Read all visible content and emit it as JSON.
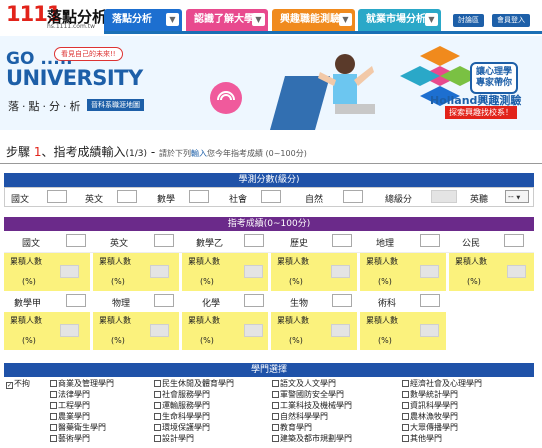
{
  "header": {
    "logo_num": "1111",
    "logo_text": "落點分析",
    "logo_url": "hs.1111.com.tw",
    "tabs": [
      {
        "label": "落點分析",
        "color": "#1d6fd0"
      },
      {
        "label": "認識了解大學",
        "color": "#e84a8e"
      },
      {
        "label": "興趣職能測驗",
        "color": "#f08a1d"
      },
      {
        "label": "就業市場分析",
        "color": "#2aa8c8"
      }
    ],
    "login": "討論區",
    "member": "會員登入"
  },
  "banner": {
    "bubble": "看見自己的未來!!",
    "go": "GO .....",
    "university": "UNIVERSITY",
    "zh": "落‧點‧分‧析",
    "map": "晉科系職涯地圖",
    "right_title": "讓心理學\n專家帶你",
    "holland": "Holland興趣測驗",
    "holland_sub": "探索興趣找校系！"
  },
  "step": {
    "prefix": "步驟 ",
    "num": "1",
    "title": "、指考成績輸入",
    "pages": "(1/3)",
    "dash": " - ",
    "hint_a": "請於下列",
    "hint_b": "輸入",
    "hint_c": "您今年指考成績 (0~100分)"
  },
  "gsat": {
    "header": "學測分數(級分)",
    "fields": [
      "國文",
      "英文",
      "數學",
      "社會",
      "自然",
      "總級分",
      "英聽"
    ],
    "select_value": "--"
  },
  "ast": {
    "header": "指考成績(0~100分)",
    "row1": [
      "國文",
      "英文",
      "數學乙",
      "歷史",
      "地理",
      "公民"
    ],
    "row2": [
      "數學甲",
      "物理",
      "化學",
      "生物",
      "術科"
    ],
    "cum_label": "累積人數",
    "pct_label": "(%)"
  },
  "majors": {
    "header": "學門選擇",
    "col1": [
      "不拘",
      "",
      "",
      "",
      "",
      ""
    ],
    "col2": [
      "商業及管理學門",
      "法律學門",
      "工程學門",
      "農業學門",
      "醫藥衛生學門",
      "藝術學門"
    ],
    "col3": [
      "民生休閒及體育學門",
      "社會服務學門",
      "運輸服務學門",
      "生命科學學門",
      "環境保護學門",
      "設計學門"
    ],
    "col4": [
      "語文及人文學門",
      "軍警國防安全學門",
      "工業科技及機械學門",
      "自然科學學門",
      "教育學門",
      "建築及都市規劃學門"
    ],
    "col5": [
      "經濟社會及心理學門",
      "數學統計學門",
      "資訊科學學門",
      "農林漁牧學門",
      "大眾傳播學門",
      "其他學門"
    ],
    "col1_checked": true
  }
}
